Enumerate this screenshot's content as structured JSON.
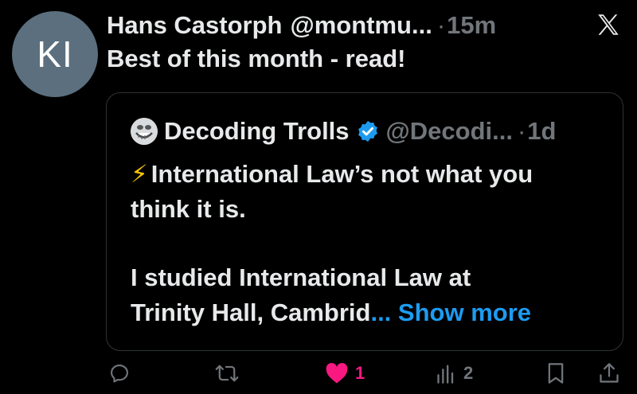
{
  "author": {
    "avatar_initials": "KI",
    "name": "Hans Castorph",
    "handle": "@montmu...",
    "time": "15m"
  },
  "tweet": {
    "text": "Best of this month - read!"
  },
  "quoted": {
    "name": "Decoding Trolls",
    "handle": "@Decodi...",
    "time": "1d",
    "line1": "International Law’s not what you",
    "line2": "think it is.",
    "line3": "I studied International Law at",
    "line4_text": "Trinity Hall, Cambrid",
    "line4_ellipsis": "...",
    "show_more": "Show more"
  },
  "actions": {
    "likes": "1",
    "views": "2"
  },
  "separator": "·",
  "colors": {
    "background": "#000000",
    "accent": "#1d9bf0",
    "like": "#f91880",
    "muted": "#71767b"
  }
}
